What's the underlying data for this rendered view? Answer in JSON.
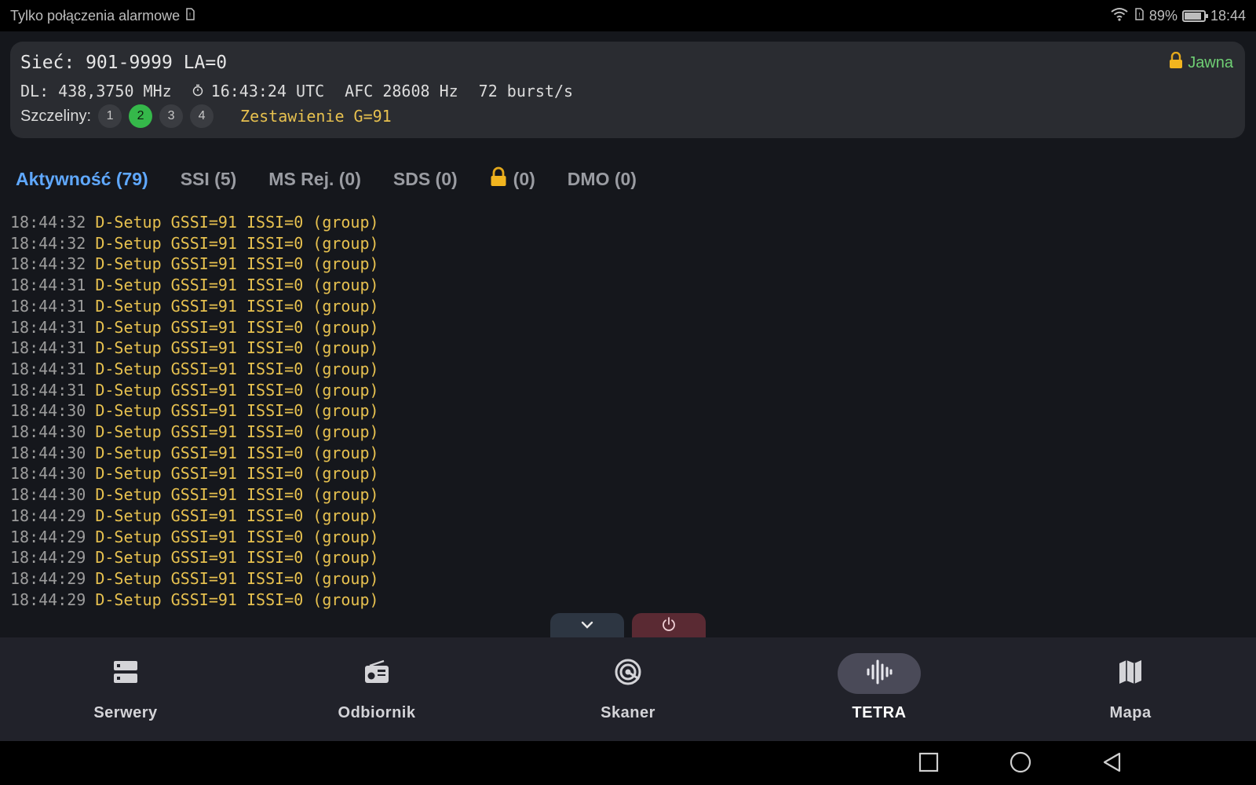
{
  "status_bar": {
    "carrier_text": "Tylko połączenia alarmowe",
    "battery_percent": "89%",
    "battery_level": 0.89,
    "time": "18:44"
  },
  "info": {
    "network": "Sieć: 901-9999 LA=0",
    "mode_label": "Jawna",
    "downlink": "DL: 438,3750 MHz",
    "utc_time": "16:43:24 UTC",
    "afc": "AFC 28608 Hz",
    "burst_rate": "72 burst/s",
    "slots_label": "Szczeliny:",
    "slots": [
      {
        "number": "1",
        "active": false
      },
      {
        "number": "2",
        "active": true
      },
      {
        "number": "3",
        "active": false
      },
      {
        "number": "4",
        "active": false
      }
    ],
    "assignment": "Zestawienie G=91"
  },
  "tabs": [
    {
      "label": "Aktywność (79)",
      "active": true
    },
    {
      "label": "SSI (5)",
      "active": false
    },
    {
      "label": "MS Rej. (0)",
      "active": false
    },
    {
      "label": "SDS (0)",
      "active": false
    },
    {
      "label": "(0)",
      "icon": "lock-icon",
      "active": false
    },
    {
      "label": "DMO (0)",
      "active": false
    }
  ],
  "log": [
    {
      "time": "18:44:32",
      "message": "D-Setup GSSI=91 ISSI=0 (group)"
    },
    {
      "time": "18:44:32",
      "message": "D-Setup GSSI=91 ISSI=0 (group)"
    },
    {
      "time": "18:44:32",
      "message": "D-Setup GSSI=91 ISSI=0 (group)"
    },
    {
      "time": "18:44:31",
      "message": "D-Setup GSSI=91 ISSI=0 (group)"
    },
    {
      "time": "18:44:31",
      "message": "D-Setup GSSI=91 ISSI=0 (group)"
    },
    {
      "time": "18:44:31",
      "message": "D-Setup GSSI=91 ISSI=0 (group)"
    },
    {
      "time": "18:44:31",
      "message": "D-Setup GSSI=91 ISSI=0 (group)"
    },
    {
      "time": "18:44:31",
      "message": "D-Setup GSSI=91 ISSI=0 (group)"
    },
    {
      "time": "18:44:31",
      "message": "D-Setup GSSI=91 ISSI=0 (group)"
    },
    {
      "time": "18:44:30",
      "message": "D-Setup GSSI=91 ISSI=0 (group)"
    },
    {
      "time": "18:44:30",
      "message": "D-Setup GSSI=91 ISSI=0 (group)"
    },
    {
      "time": "18:44:30",
      "message": "D-Setup GSSI=91 ISSI=0 (group)"
    },
    {
      "time": "18:44:30",
      "message": "D-Setup GSSI=91 ISSI=0 (group)"
    },
    {
      "time": "18:44:30",
      "message": "D-Setup GSSI=91 ISSI=0 (group)"
    },
    {
      "time": "18:44:29",
      "message": "D-Setup GSSI=91 ISSI=0 (group)"
    },
    {
      "time": "18:44:29",
      "message": "D-Setup GSSI=91 ISSI=0 (group)"
    },
    {
      "time": "18:44:29",
      "message": "D-Setup GSSI=91 ISSI=0 (group)"
    },
    {
      "time": "18:44:29",
      "message": "D-Setup GSSI=91 ISSI=0 (group)"
    },
    {
      "time": "18:44:29",
      "message": "D-Setup GSSI=91 ISSI=0 (group)"
    }
  ],
  "bottom_nav": [
    {
      "label": "Serwery",
      "icon": "server-icon",
      "active": false
    },
    {
      "label": "Odbiornik",
      "icon": "radio-icon",
      "active": false
    },
    {
      "label": "Skaner",
      "icon": "scanner-icon",
      "active": false
    },
    {
      "label": "TETRA",
      "icon": "waveform-icon",
      "active": true
    },
    {
      "label": "Mapa",
      "icon": "map-icon",
      "active": false
    }
  ],
  "colors": {
    "accent_tab": "#5fa8ff",
    "log_message": "#e7c14f",
    "slot_active": "#35b84a",
    "mode_badge": "#6fcf74"
  }
}
